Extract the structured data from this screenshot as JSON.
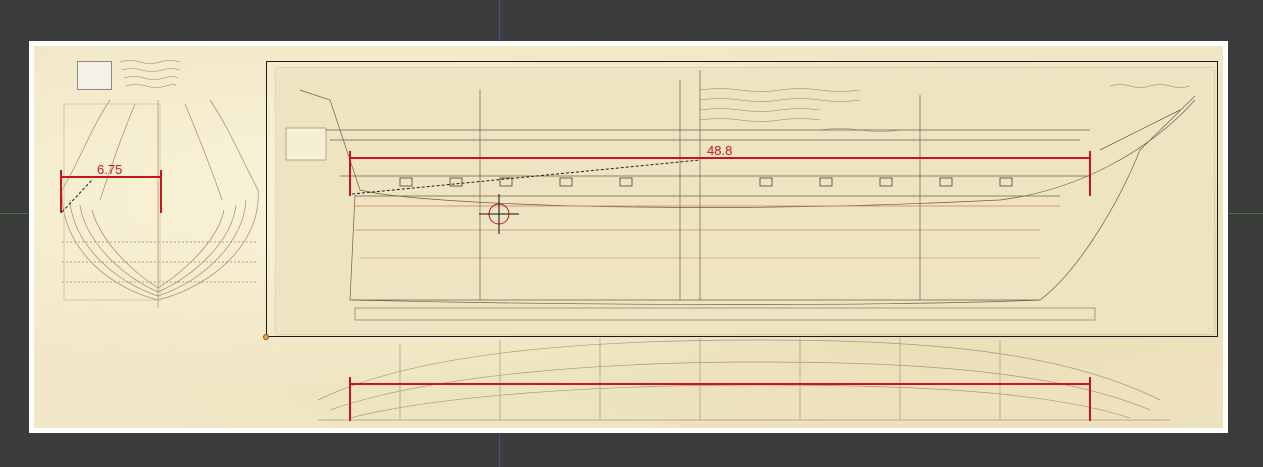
{
  "viewport": {
    "background": "#3c3c3c",
    "guide_colors": {
      "vertical": "#4c4c8a",
      "horizontal": "#3f7a3f"
    }
  },
  "document": {
    "paper_color": "#f1e7c6",
    "stamp_label": "stamp-icon"
  },
  "measurements": [
    {
      "name": "beam-width",
      "label": "6.75"
    },
    {
      "name": "deck-length",
      "label": "48.8"
    },
    {
      "name": "keel-length",
      "label": ""
    }
  ],
  "annotation_color": "#c4161c",
  "crop_region": {
    "handle_color": "#f2a13a"
  }
}
